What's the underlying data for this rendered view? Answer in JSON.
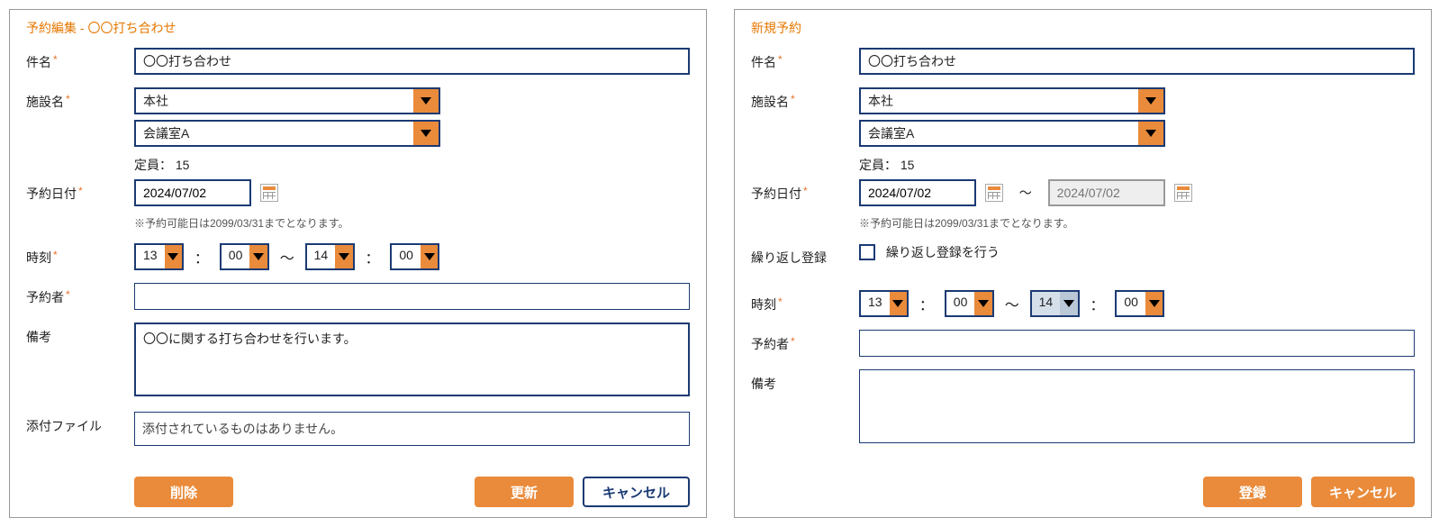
{
  "left": {
    "title": "予約編集 - 〇〇打ち合わせ",
    "subject_label": "件名",
    "subject_value": "〇〇打ち合わせ",
    "facility_label": "施設名",
    "facility_value": "本社",
    "room_value": "会議室A",
    "capacity_label": "定員：",
    "capacity_value": "15",
    "date_label": "予約日付",
    "date_value": "2024/07/02",
    "date_note": "※予約可能日は2099/03/31までとなります。",
    "time_label": "時刻",
    "time_h1": "13",
    "time_m1": "00",
    "time_h2": "14",
    "time_m2": "00",
    "reserver_label": "予約者",
    "reserver_value": "",
    "notes_label": "備考",
    "notes_value": "〇〇に関する打ち合わせを行います。",
    "attach_label": "添付ファイル",
    "attach_text": "添付されているものはありません。",
    "btn_delete": "削除",
    "btn_update": "更新",
    "btn_cancel": "キャンセル"
  },
  "right": {
    "title": "新規予約",
    "subject_label": "件名",
    "subject_value": "〇〇打ち合わせ",
    "facility_label": "施設名",
    "facility_value": "本社",
    "room_value": "会議室A",
    "capacity_label": "定員：",
    "capacity_value": "15",
    "date_label": "予約日付",
    "date_from": "2024/07/02",
    "date_to_placeholder": "2024/07/02",
    "date_note": "※予約可能日は2099/03/31までとなります。",
    "repeat_label": "繰り返し登録",
    "repeat_chk_label": "繰り返し登録を行う",
    "time_label": "時刻",
    "time_h1": "13",
    "time_m1": "00",
    "time_h2": "14",
    "time_m2": "00",
    "reserver_label": "予約者",
    "reserver_value": "",
    "notes_label": "備考",
    "notes_value": "",
    "btn_register": "登録",
    "btn_cancel": "キャンセル"
  },
  "sym": {
    "colon": "：",
    "tilde": "～"
  }
}
